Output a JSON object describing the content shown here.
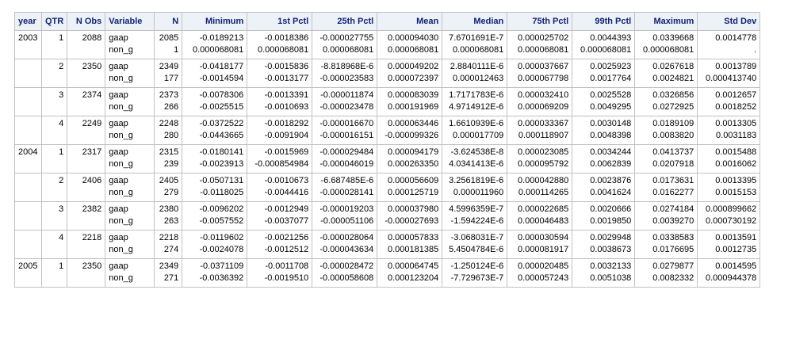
{
  "table": {
    "headers": [
      "year",
      "QTR",
      "N Obs",
      "Variable",
      "N",
      "Minimum",
      "1st Pctl",
      "25th Pctl",
      "Mean",
      "Median",
      "75th Pctl",
      "99th Pctl",
      "Maximum",
      "Std Dev"
    ],
    "rows": [
      {
        "year": "2003",
        "qtr": "1",
        "nobs": "2088",
        "vars": [
          "gaap",
          "non_g"
        ],
        "stats": [
          [
            "2085",
            "1"
          ],
          [
            "-0.0189213",
            "0.000068081"
          ],
          [
            "-0.0018386",
            "0.000068081"
          ],
          [
            "-0.000027755",
            "0.000068081"
          ],
          [
            "0.000094030",
            "0.000068081"
          ],
          [
            "7.6701691E-7",
            "0.000068081"
          ],
          [
            "0.000025702",
            "0.000068081"
          ],
          [
            "0.0044393",
            "0.000068081"
          ],
          [
            "0.0339668",
            "0.000068081"
          ],
          [
            "0.0014778",
            "."
          ]
        ]
      },
      {
        "year": "",
        "qtr": "2",
        "nobs": "2350",
        "vars": [
          "gaap",
          "non_g"
        ],
        "stats": [
          [
            "2349",
            "177"
          ],
          [
            "-0.0418177",
            "-0.0014594"
          ],
          [
            "-0.0015836",
            "-0.0013177"
          ],
          [
            "-8.818968E-6",
            "-0.000023583"
          ],
          [
            "0.000049202",
            "0.000072397"
          ],
          [
            "2.8840111E-6",
            "0.000012463"
          ],
          [
            "0.000037667",
            "0.000067798"
          ],
          [
            "0.0025923",
            "0.0017764"
          ],
          [
            "0.0267618",
            "0.0024821"
          ],
          [
            "0.0013789",
            "0.000413740"
          ]
        ]
      },
      {
        "year": "",
        "qtr": "3",
        "nobs": "2374",
        "vars": [
          "gaap",
          "non_g"
        ],
        "stats": [
          [
            "2373",
            "266"
          ],
          [
            "-0.0078306",
            "-0.0025515"
          ],
          [
            "-0.0013391",
            "-0.0010693"
          ],
          [
            "-0.000011874",
            "-0.000023478"
          ],
          [
            "0.000083039",
            "0.000191969"
          ],
          [
            "1.7171783E-6",
            "4.9714912E-6"
          ],
          [
            "0.000032410",
            "0.000069209"
          ],
          [
            "0.0025528",
            "0.0049295"
          ],
          [
            "0.0326856",
            "0.0272925"
          ],
          [
            "0.0012657",
            "0.0018252"
          ]
        ]
      },
      {
        "year": "",
        "qtr": "4",
        "nobs": "2249",
        "vars": [
          "gaap",
          "non_g"
        ],
        "stats": [
          [
            "2248",
            "280"
          ],
          [
            "-0.0372522",
            "-0.0443665"
          ],
          [
            "-0.0018292",
            "-0.0091904"
          ],
          [
            "-0.000016670",
            "-0.000016151"
          ],
          [
            "0.000063446",
            "-0.000099326"
          ],
          [
            "1.6610939E-6",
            "0.000017709"
          ],
          [
            "0.000033367",
            "0.000118907"
          ],
          [
            "0.0030148",
            "0.0048398"
          ],
          [
            "0.0189109",
            "0.0083820"
          ],
          [
            "0.0013305",
            "0.0031183"
          ]
        ]
      },
      {
        "year": "2004",
        "qtr": "1",
        "nobs": "2317",
        "vars": [
          "gaap",
          "non_g"
        ],
        "stats": [
          [
            "2315",
            "239"
          ],
          [
            "-0.0180141",
            "-0.0023913"
          ],
          [
            "-0.0015969",
            "-0.000854984"
          ],
          [
            "-0.000029484",
            "-0.000046019"
          ],
          [
            "0.000094179",
            "0.000263350"
          ],
          [
            "-3.624538E-8",
            "4.0341413E-6"
          ],
          [
            "0.000023085",
            "0.000095792"
          ],
          [
            "0.0034244",
            "0.0062839"
          ],
          [
            "0.0413737",
            "0.0207918"
          ],
          [
            "0.0015488",
            "0.0016062"
          ]
        ]
      },
      {
        "year": "",
        "qtr": "2",
        "nobs": "2406",
        "vars": [
          "gaap",
          "non_g"
        ],
        "stats": [
          [
            "2405",
            "279"
          ],
          [
            "-0.0507131",
            "-0.0118025"
          ],
          [
            "-0.0010673",
            "-0.0044416"
          ],
          [
            "-6.687485E-6",
            "-0.000028141"
          ],
          [
            "0.000056609",
            "0.000125719"
          ],
          [
            "3.2561819E-6",
            "0.000011960"
          ],
          [
            "0.000042880",
            "0.000114265"
          ],
          [
            "0.0023876",
            "0.0041624"
          ],
          [
            "0.0173631",
            "0.0162277"
          ],
          [
            "0.0013395",
            "0.0015153"
          ]
        ]
      },
      {
        "year": "",
        "qtr": "3",
        "nobs": "2382",
        "vars": [
          "gaap",
          "non_g"
        ],
        "stats": [
          [
            "2380",
            "263"
          ],
          [
            "-0.0096202",
            "-0.0057552"
          ],
          [
            "-0.0012949",
            "-0.0037077"
          ],
          [
            "-0.000019203",
            "-0.000051106"
          ],
          [
            "0.000037980",
            "-0.000027693"
          ],
          [
            "4.5996359E-7",
            "-1.594224E-6"
          ],
          [
            "0.000022685",
            "0.000046483"
          ],
          [
            "0.0020666",
            "0.0019850"
          ],
          [
            "0.0274184",
            "0.0039270"
          ],
          [
            "0.000899662",
            "0.000730192"
          ]
        ]
      },
      {
        "year": "",
        "qtr": "4",
        "nobs": "2218",
        "vars": [
          "gaap",
          "non_g"
        ],
        "stats": [
          [
            "2218",
            "274"
          ],
          [
            "-0.0119602",
            "-0.0024078"
          ],
          [
            "-0.0021256",
            "-0.0012512"
          ],
          [
            "-0.000028064",
            "-0.000043634"
          ],
          [
            "0.000057833",
            "0.000181385"
          ],
          [
            "-3.068031E-7",
            "5.4504784E-6"
          ],
          [
            "0.000030594",
            "0.000081917"
          ],
          [
            "0.0029948",
            "0.0038673"
          ],
          [
            "0.0338583",
            "0.0176695"
          ],
          [
            "0.0013591",
            "0.0012735"
          ]
        ]
      },
      {
        "year": "2005",
        "qtr": "1",
        "nobs": "2350",
        "vars": [
          "gaap",
          "non_g"
        ],
        "stats": [
          [
            "2349",
            "271"
          ],
          [
            "-0.0371109",
            "-0.0036392"
          ],
          [
            "-0.0011708",
            "-0.0019510"
          ],
          [
            "-0.000028472",
            "-0.000058608"
          ],
          [
            "0.000064745",
            "0.000123204"
          ],
          [
            "-1.250124E-6",
            "-7.729673E-7"
          ],
          [
            "0.000020485",
            "0.000057243"
          ],
          [
            "0.0032133",
            "0.0051038"
          ],
          [
            "0.0279877",
            "0.0082332"
          ],
          [
            "0.0014595",
            "0.000944378"
          ]
        ]
      }
    ]
  }
}
